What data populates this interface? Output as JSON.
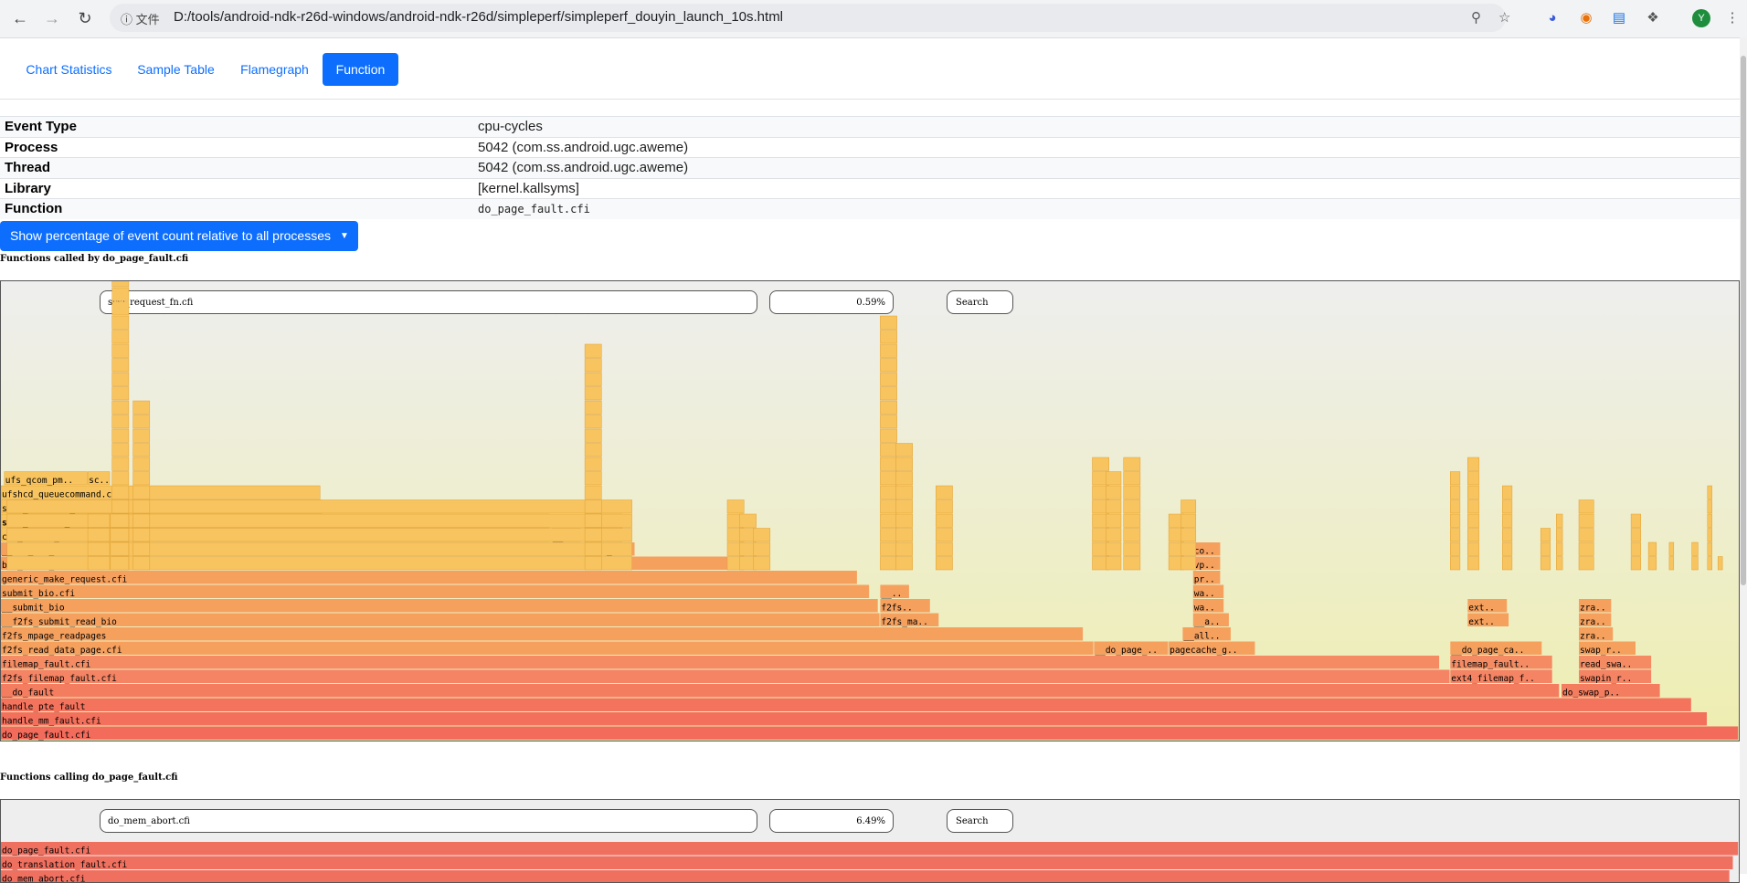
{
  "browser": {
    "info_label": "文件",
    "url": "D:/tools/android-ndk-r26d-windows/android-ndk-r26d/simpleperf/simpleperf_douyin_launch_10s.html",
    "avatar_initial": "Y"
  },
  "tabs": [
    {
      "label": "Chart Statistics"
    },
    {
      "label": "Sample Table"
    },
    {
      "label": "Flamegraph"
    },
    {
      "label": "Function"
    }
  ],
  "info": {
    "event_type": {
      "key": "Event Type",
      "value": "cpu-cycles"
    },
    "process": {
      "key": "Process",
      "value": "5042 (com.ss.android.ugc.aweme)"
    },
    "thread": {
      "key": "Thread",
      "value": "5042 (com.ss.android.ugc.aweme)"
    },
    "library": {
      "key": "Library",
      "value": "[kernel.kallsyms]"
    },
    "function": {
      "key": "Function",
      "value": "do_page_fault.cfi"
    }
  },
  "percentage_button": {
    "label": "Show percentage of event count relative to all processes"
  },
  "callee_graph": {
    "title": "Functions called by do_page_fault.cfi",
    "hovered_function": "scsi_request_fn.cfi",
    "percent": "0.59%",
    "search_label": "Search",
    "frames": [
      {
        "label": "do_page_fault.cfi",
        "depth": 0,
        "start": 0.0,
        "width": 100.0
      },
      {
        "label": "handle_mm_fault.cfi",
        "depth": 1,
        "start": 0.0,
        "width": 98.2
      },
      {
        "label": "handle_pte_fault",
        "depth": 2,
        "start": 0.0,
        "width": 97.3
      },
      {
        "label": "__do_fault",
        "depth": 3,
        "start": 0.0,
        "width": 89.7
      },
      {
        "label": "do_swap_p..",
        "depth": 3,
        "start": 89.8,
        "width": 5.7
      },
      {
        "label": "f2fs_filemap_fault.cfi",
        "depth": 4,
        "start": 0.0,
        "width": 83.4
      },
      {
        "label": "ext4_filemap_f..",
        "depth": 4,
        "start": 83.4,
        "width": 5.9
      },
      {
        "label": "swapin_r..",
        "depth": 4,
        "start": 90.8,
        "width": 4.2
      },
      {
        "label": "filemap_fault.cfi",
        "depth": 5,
        "start": 0.0,
        "width": 82.8
      },
      {
        "label": "filemap_fault..",
        "depth": 5,
        "start": 83.4,
        "width": 5.9
      },
      {
        "label": "read_swa..",
        "depth": 5,
        "start": 90.8,
        "width": 4.2
      },
      {
        "label": "f2fs_read_data_page.cfi",
        "depth": 6,
        "start": 0.0,
        "width": 62.9
      },
      {
        "label": "__do_page_..",
        "depth": 6,
        "start": 62.9,
        "width": 4.3
      },
      {
        "label": "pagecache_g..",
        "depth": 6,
        "start": 67.2,
        "width": 5.0
      },
      {
        "label": "__do_page_ca..",
        "depth": 6,
        "start": 83.4,
        "width": 5.3
      },
      {
        "label": "swap_r..",
        "depth": 6,
        "start": 90.8,
        "width": 3.3
      },
      {
        "label": "f2fs_mpage_readpages",
        "depth": 7,
        "start": 0.0,
        "width": 62.3
      },
      {
        "label": "__all..",
        "depth": 7,
        "start": 68.0,
        "width": 2.8
      },
      {
        "label": "zra..",
        "depth": 7,
        "start": 90.8,
        "width": 2.0
      },
      {
        "label": "__f2fs_submit_read_bio",
        "depth": 8,
        "start": 0.0,
        "width": 50.6
      },
      {
        "label": "f2fs_ma..",
        "depth": 8,
        "start": 50.6,
        "width": 3.4
      },
      {
        "label": "__a..",
        "depth": 8,
        "start": 68.6,
        "width": 2.1
      },
      {
        "label": "ext..",
        "depth": 8,
        "start": 84.4,
        "width": 2.4
      },
      {
        "label": "zra..",
        "depth": 8,
        "start": 90.8,
        "width": 1.9
      },
      {
        "label": "__submit_bio",
        "depth": 9,
        "start": 0.0,
        "width": 50.5
      },
      {
        "label": "f2fs..",
        "depth": 9,
        "start": 50.6,
        "width": 2.9
      },
      {
        "label": "wa..",
        "depth": 9,
        "start": 68.6,
        "width": 1.8
      },
      {
        "label": "ext..",
        "depth": 9,
        "start": 84.4,
        "width": 2.3
      },
      {
        "label": "zra..",
        "depth": 9,
        "start": 90.8,
        "width": 1.9
      },
      {
        "label": "submit_bio.cfi",
        "depth": 10,
        "start": 0.0,
        "width": 50.0
      },
      {
        "label": "__..",
        "depth": 10,
        "start": 50.6,
        "width": 1.7
      },
      {
        "label": "wa..",
        "depth": 10,
        "start": 68.6,
        "width": 1.8
      },
      {
        "label": "generic_make_request.cfi",
        "depth": 11,
        "start": 0.0,
        "width": 49.3
      },
      {
        "label": "pr..",
        "depth": 11,
        "start": 68.6,
        "width": 1.6
      },
      {
        "label": "blk_queue_bio.cfi",
        "depth": 12,
        "start": 0.0,
        "width": 44.0
      },
      {
        "label": "vp..",
        "depth": 12,
        "start": 68.6,
        "width": 1.6
      },
      {
        "label": "co..",
        "depth": 13,
        "start": 68.6,
        "width": 1.6
      },
      {
        "label": "__elv_add_request.cfi",
        "depth": 13,
        "start": 0.0,
        "width": 31.7
      },
      {
        "label": "get..",
        "depth": 13,
        "start": 31.7,
        "width": 1.8
      },
      {
        "label": "scsi_r..",
        "depth": 13,
        "start": 33.6,
        "width": 2.9
      },
      {
        "label": "cfq_insert_request.cfi",
        "depth": 14,
        "start": 0.0,
        "width": 31.6
      },
      {
        "label": "__..",
        "depth": 14,
        "start": 31.7,
        "width": 1.7
      },
      {
        "label": "scs..",
        "depth": 14,
        "start": 33.6,
        "width": 2.2
      },
      {
        "label": "scsi_request_fn.cfi",
        "depth": 15,
        "start": 0.0,
        "width": 31.6,
        "bold": true
      },
      {
        "label": "ufs..",
        "depth": 15,
        "start": 33.6,
        "width": 2.2
      },
      {
        "label": "scsi_dispatch_cmd",
        "depth": 16,
        "start": 0.0,
        "width": 18.5
      },
      {
        "label": "ufshcd_queuecommand.cfi",
        "depth": 17,
        "start": 0.0,
        "width": 18.4
      },
      {
        "label": "ufs_qcom_pm..",
        "depth": 18,
        "start": 0.2,
        "width": 4.8
      },
      {
        "label": "sc..",
        "depth": 18,
        "start": 5.0,
        "width": 1.3
      }
    ]
  },
  "caller_graph": {
    "title": "Functions calling do_page_fault.cfi",
    "hovered_function": "do_mem_abort.cfi",
    "percent": "6.49%",
    "search_label": "Search",
    "frames": [
      {
        "label": "do_page_fault.cfi",
        "depth": 0,
        "start": 0.0,
        "width": 100.0
      },
      {
        "label": "do_translation_fault.cfi",
        "depth": 1,
        "start": 0.0,
        "width": 99.7
      },
      {
        "label": "do_mem_abort.cfi",
        "depth": 2,
        "start": 0.0,
        "width": 99.5
      }
    ]
  }
}
